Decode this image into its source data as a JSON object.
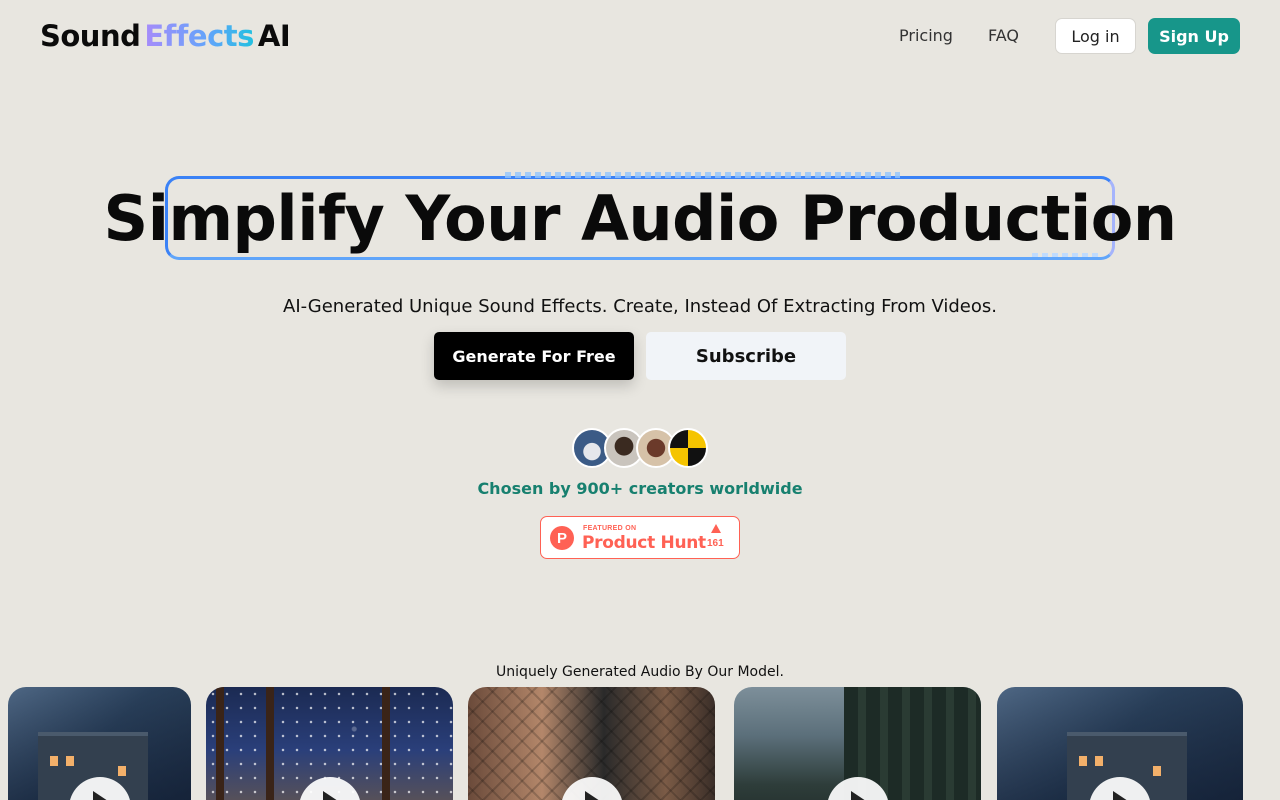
{
  "header": {
    "logo": {
      "word1": "Sound",
      "word2": "Effects",
      "word3": "AI"
    },
    "nav": [
      {
        "label": "Pricing"
      },
      {
        "label": "FAQ"
      }
    ],
    "login_label": "Log in",
    "signup_label": "Sign Up"
  },
  "hero": {
    "title": "Simplify Your Audio Production",
    "subtitle": "AI-Generated Unique Sound Effects. Create, Instead Of Extracting From Videos.",
    "primary_cta": "Generate For Free",
    "secondary_cta": "Subscribe",
    "social_proof": "Chosen by 900+ creators worldwide"
  },
  "product_hunt": {
    "featured_label": "FEATURED ON",
    "name": "Product Hunt",
    "logo_letter": "P",
    "upvotes": "161"
  },
  "gallery": {
    "caption": "Uniquely Generated Audio By Our Model.",
    "items": [
      {
        "scene": "rainy house at night"
      },
      {
        "scene": "snowy night through porch"
      },
      {
        "scene": "fighters in cage"
      },
      {
        "scene": "foggy forest"
      },
      {
        "scene": "rainy house at night"
      }
    ]
  },
  "colors": {
    "background": "#e8e6e0",
    "brand_teal": "#17968a",
    "product_hunt": "#ff6154",
    "hero_border": "#3b82f6"
  }
}
